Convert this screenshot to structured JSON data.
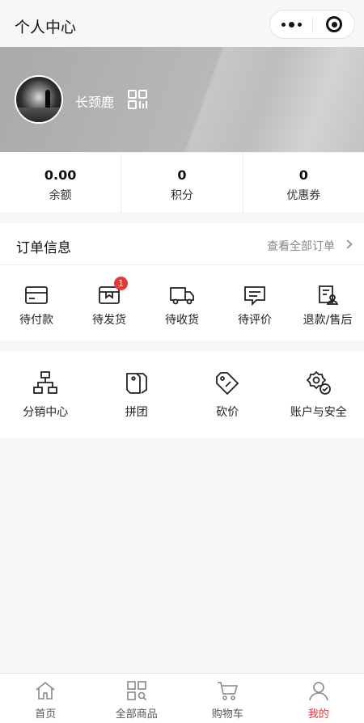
{
  "nav": {
    "title": "个人中心"
  },
  "profile": {
    "username": "长颈鹿"
  },
  "stats": [
    {
      "value": "0.00",
      "label": "余额"
    },
    {
      "value": "0",
      "label": "积分"
    },
    {
      "value": "0",
      "label": "优惠券"
    }
  ],
  "orders": {
    "title": "订单信息",
    "view_all": "查看全部订单",
    "items": [
      {
        "label": "待付款",
        "icon": "card-icon"
      },
      {
        "label": "待发货",
        "icon": "box-icon",
        "badge": "1"
      },
      {
        "label": "待收货",
        "icon": "truck-icon"
      },
      {
        "label": "待评价",
        "icon": "comment-icon"
      },
      {
        "label": "退款/售后",
        "icon": "refund-icon"
      }
    ]
  },
  "tools": [
    {
      "label": "分销中心",
      "icon": "org-chart-icon"
    },
    {
      "label": "拼团",
      "icon": "tags-icon"
    },
    {
      "label": "砍价",
      "icon": "price-tag-icon"
    },
    {
      "label": "账户与安全",
      "icon": "settings-shield-icon"
    }
  ],
  "tabbar": {
    "active_color": "#e4393c",
    "items": [
      {
        "label": "首页",
        "icon": "home-icon"
      },
      {
        "label": "全部商品",
        "icon": "grid-icon"
      },
      {
        "label": "购物车",
        "icon": "cart-icon"
      },
      {
        "label": "我的",
        "icon": "user-icon"
      }
    ]
  }
}
